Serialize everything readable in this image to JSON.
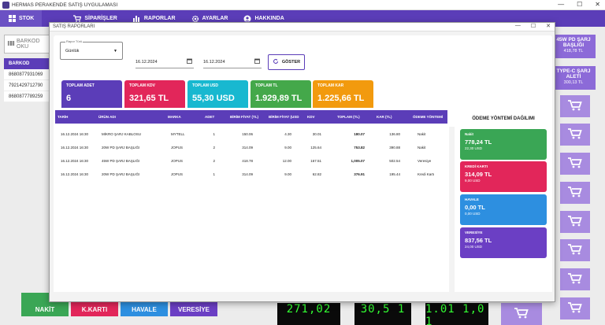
{
  "app": {
    "title": "HERMAS PERAKENDE SATIŞ UYGULAMASI",
    "nav": [
      {
        "label": "STOK",
        "icon": "grid-icon"
      },
      {
        "label": "SİPARİŞLER",
        "icon": "cart-icon"
      },
      {
        "label": "RAPORLAR",
        "icon": "chart-icon"
      },
      {
        "label": "AYARLAR",
        "icon": "gear-icon"
      },
      {
        "label": "HAKKINDA",
        "icon": "user-icon"
      }
    ],
    "window_controls": [
      "—",
      "☐",
      "✕"
    ]
  },
  "left": {
    "barcode_placeholder": "BARKOD OKU",
    "barcode_header": "BARKOD",
    "barcodes": [
      "8680877931069",
      "7921429712790",
      "8680877789259"
    ]
  },
  "right": {
    "products": [
      {
        "name": "45W PD ŞARJ BAŞLIĞI",
        "price": "418,78 TL"
      },
      {
        "name": "TYPE-C ŞARJ ALETİ",
        "price": "300,13 TL"
      }
    ]
  },
  "bottom": {
    "pay_buttons": [
      {
        "label": "NAKİT",
        "color": "#3aa655"
      },
      {
        "label": "K.KARTI",
        "color": "#e2265a"
      },
      {
        "label": "HAVALE",
        "color": "#2d8fe0"
      },
      {
        "label": "VERESİYE",
        "color": "#6b3fc4"
      }
    ],
    "lcd": [
      "271,02",
      "30,5 1",
      "1.01 1,0 1"
    ]
  },
  "dialog": {
    "title": "SATIŞ RAPORLARI",
    "period_caption": "Rapor Türü",
    "period_value": "Günlük",
    "date_start": "16.12.2024",
    "date_end": "16.12.2024",
    "show_label": "GÖSTER",
    "stats": [
      {
        "label": "TOPLAM ADET",
        "value": "6",
        "color": "#5b3db8"
      },
      {
        "label": "TOPLAM KDV",
        "value": "321,65 TL",
        "color": "#e2265a"
      },
      {
        "label": "TOPLAM USD",
        "value": "55,30 USD",
        "color": "#18b8d0"
      },
      {
        "label": "TOPLAM TL",
        "value": "1.929,89 TL",
        "color": "#44a84a"
      },
      {
        "label": "TOPLAM KAR",
        "value": "1.225,66 TL",
        "color": "#f29a0e"
      }
    ],
    "table": {
      "headers": [
        "TARİH",
        "ÜRÜN ADI",
        "MARKA",
        "ADET",
        "BİRİM FİYAT (TL)",
        "BİRİM FİYAT (USD",
        "KDV",
        "TOPLAM (TL)",
        "KAR (TL)",
        "ÖDEME YÖNTEMİ"
      ],
      "rows": [
        [
          "16.12.2024 16:30",
          "MİKRO ŞARJ KABLOSU",
          "MYTELL",
          "1",
          "150.06",
          "4.30",
          "30.01",
          "180.07",
          "136.80",
          "Nakit"
        ],
        [
          "16.12.2024 16:30",
          "20W PD ŞARJ BAŞLIĞI",
          "JOPUS",
          "2",
          "314.09",
          "9.00",
          "125.64",
          "753.82",
          "390.88",
          "Nakit"
        ],
        [
          "16.12.2024 16:30",
          "45W PD ŞARJ BAŞLIĞI",
          "JOPUS",
          "2",
          "418.78",
          "12.00",
          "167.51",
          "1,005.07",
          "502.54",
          "Veresiye"
        ],
        [
          "16.12.2024 16:30",
          "20W PD ŞARJ BAŞLIĞI",
          "JOPUS",
          "1",
          "314.09",
          "9.00",
          "62.82",
          "376.91",
          "195.44",
          "Kredi Kartı"
        ]
      ]
    },
    "payment_dist": {
      "title": "ÖDEME YÖNTEMİ DAĞILIMI",
      "items": [
        {
          "label": "Nakit",
          "tl": "778,24 TL",
          "usd": "22,30 USD",
          "color": "#3aa655"
        },
        {
          "label": "KREDİ KARTI",
          "tl": "314,09 TL",
          "usd": "9,00 USD",
          "color": "#e2265a"
        },
        {
          "label": "HAVALE",
          "tl": "0,00 TL",
          "usd": "0,00 USD",
          "color": "#2d8fe0"
        },
        {
          "label": "VERESİYE",
          "tl": "837,56 TL",
          "usd": "24,00 USD",
          "color": "#6b3fc4"
        }
      ]
    }
  }
}
